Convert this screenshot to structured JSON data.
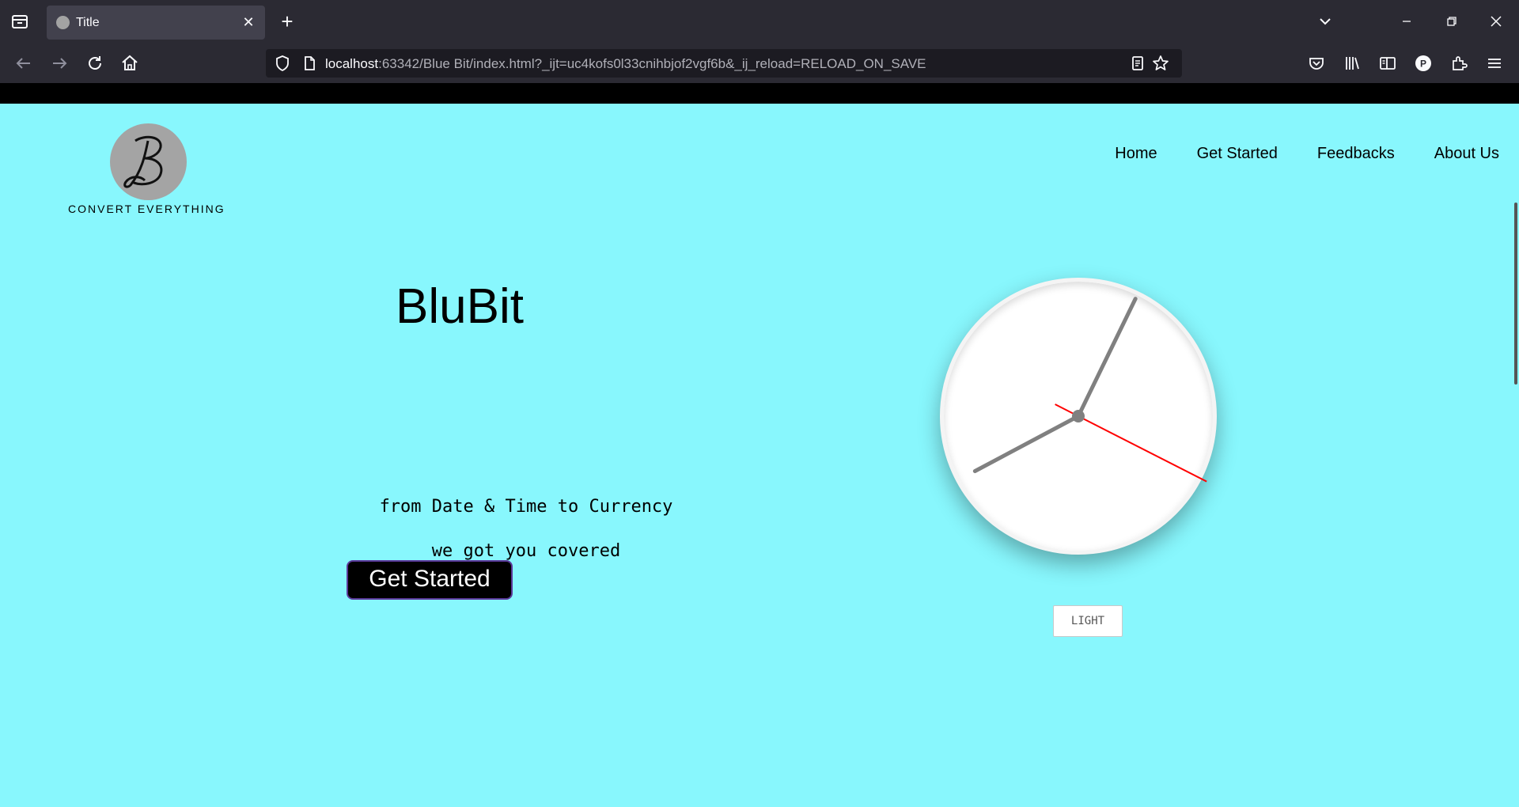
{
  "browser": {
    "tab_title": "Title",
    "url_host": "localhost",
    "url_rest": ":63342/Blue Bit/index.html?_ijt=uc4kofs0l33cnihbjof2vgf6b&_ij_reload=RELOAD_ON_SAVE"
  },
  "site": {
    "logo_tagline": "CONVERT EVERYTHING",
    "nav": [
      "Home",
      "Get Started",
      "Feedbacks",
      "About Us"
    ],
    "hero_title": "BluBit",
    "hero_line1": "from Date & Time to Currency",
    "hero_line2": "we got you covered",
    "cta_label": "Get Started",
    "theme_toggle_label": "LIGHT"
  },
  "clock": {
    "hour": 8,
    "minute": 4,
    "second": 19.5,
    "hand_color": "#808080",
    "second_hand_color": "#ff0000"
  }
}
